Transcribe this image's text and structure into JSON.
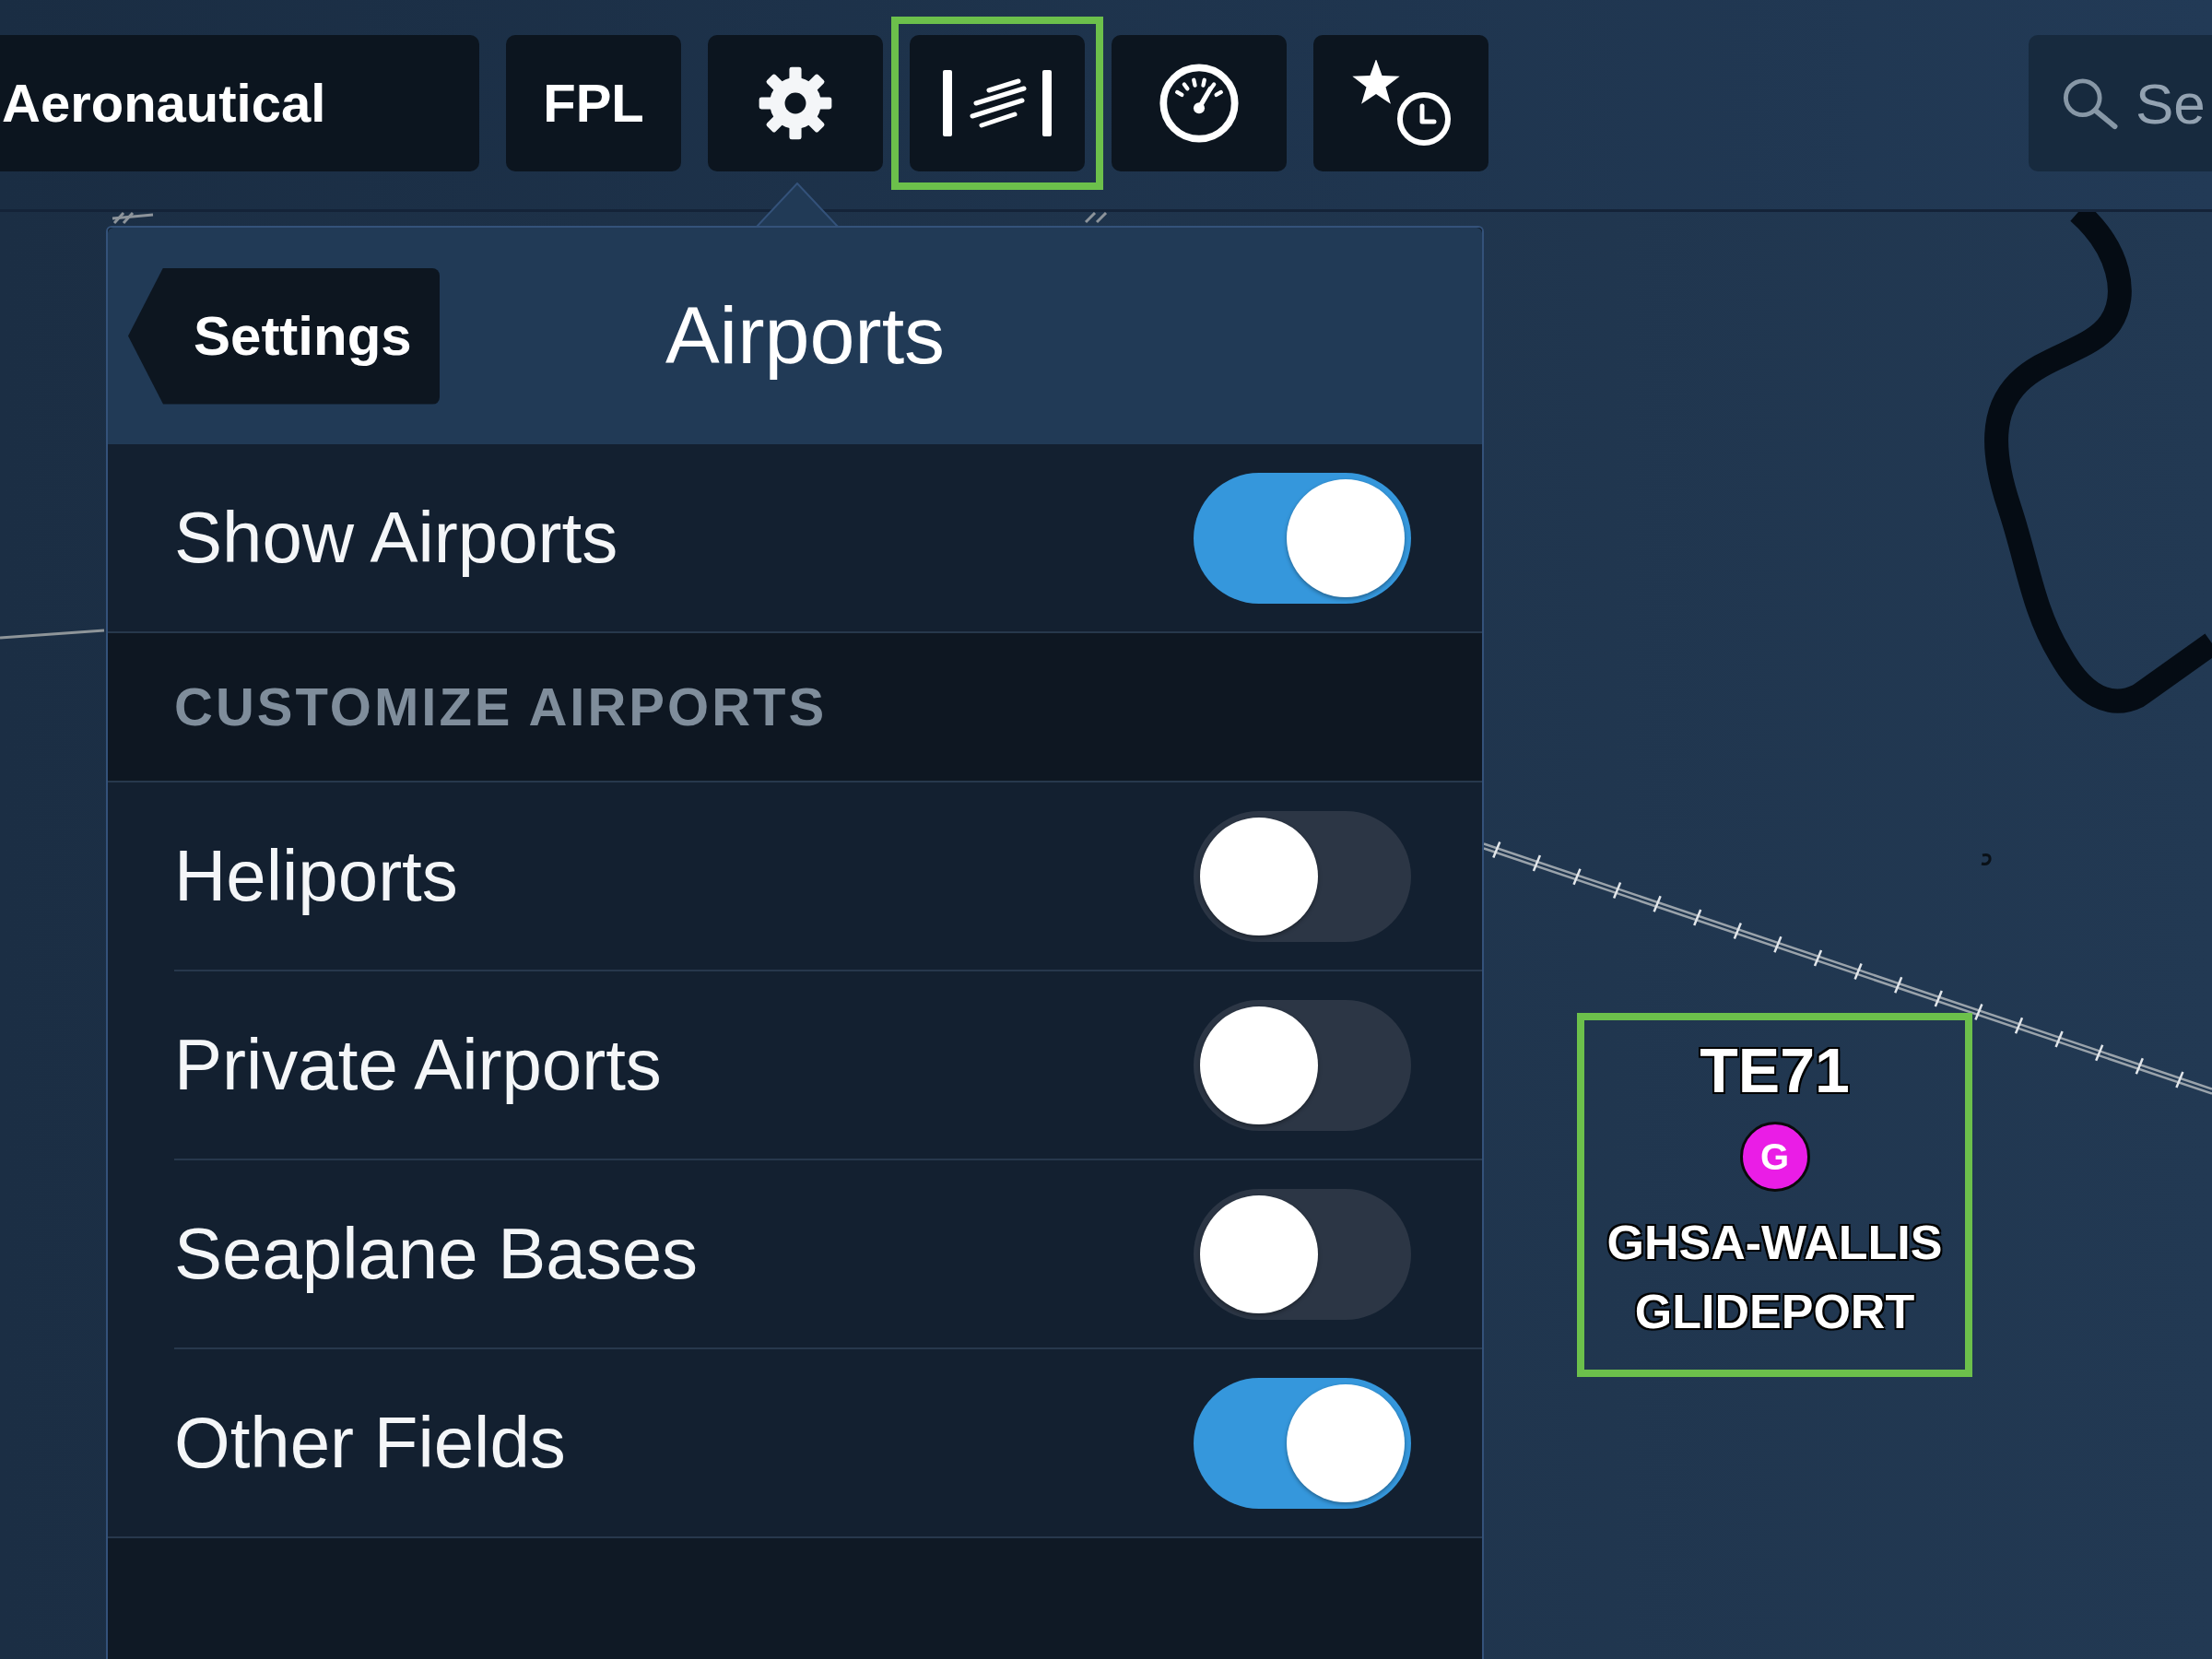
{
  "toolbar": {
    "buttons": [
      {
        "kind": "text",
        "label": "Aeronautical",
        "highlighted": false
      },
      {
        "kind": "text",
        "label": "FPL",
        "highlighted": false
      },
      {
        "kind": "icon",
        "highlighted": false
      },
      {
        "kind": "icon",
        "highlighted": true
      },
      {
        "kind": "icon",
        "highlighted": false
      },
      {
        "kind": "icon",
        "highlighted": false
      }
    ],
    "search": {
      "placeholder": "Se"
    }
  },
  "popover": {
    "back_button": "Settings",
    "title": "Airports",
    "rows": [
      {
        "kind": "toggle",
        "label": "Show Airports",
        "on": true
      },
      {
        "kind": "section",
        "label": "CUSTOMIZE AIRPORTS"
      },
      {
        "kind": "toggle",
        "label": "Heliports",
        "on": false
      },
      {
        "kind": "toggle",
        "label": "Private Airports",
        "on": false
      },
      {
        "kind": "toggle",
        "label": "Seaplane Bases",
        "on": false
      },
      {
        "kind": "toggle",
        "label": "Other Fields",
        "on": true
      }
    ]
  },
  "map": {
    "marker": {
      "code": "TE71",
      "symbol": "G",
      "name": "GHSA-WALLIS GLIDEPORT",
      "highlighted": true
    }
  }
}
